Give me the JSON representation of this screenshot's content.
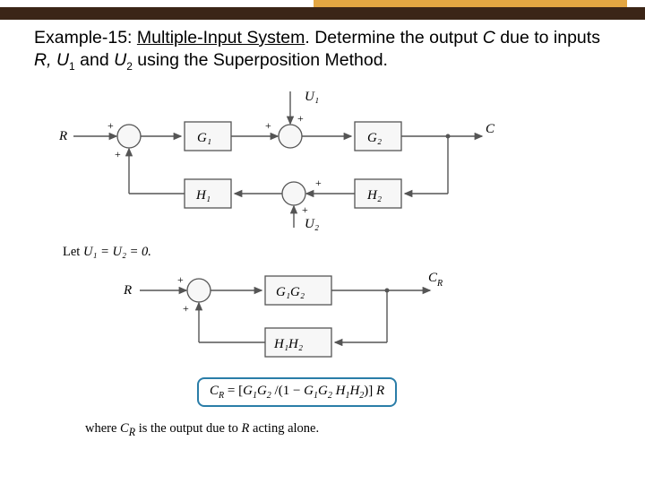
{
  "heading": {
    "example_label": "Example-15:",
    "underlined": "Multiple-Input System",
    "rest1": ". Determine the output ",
    "C": "C",
    "rest2": " due to inputs ",
    "R": "R",
    "comma": ", ",
    "U1": "U",
    "sub1": "1",
    "and": " and ",
    "U2": "U",
    "sub2": "2",
    "rest3": " using the Superposition Method."
  },
  "diagram1": {
    "R": "R",
    "G1": "G₁",
    "G2": "G₂",
    "H1": "H₁",
    "H2": "H₂",
    "U1": "U₁",
    "U2": "U₂",
    "C": "C",
    "plus": "+",
    "minus": ""
  },
  "let_line": {
    "let": "Let ",
    "eq": "U₁ = U₂ = 0."
  },
  "diagram2": {
    "R": "R",
    "G1G2": "G₁G₂",
    "H1H2": "H₁H₂",
    "CR": "C",
    "CR_sub": "R",
    "plus": "+"
  },
  "equation": {
    "text": "C_R = [G₁G₂ /(1 − G₁G₂ H₁H₂)] R"
  },
  "bottom": {
    "where": "where ",
    "CR": "C",
    "CR_sub": "R",
    "rest": " is the output due to ",
    "R": "R",
    "tail": " acting alone."
  },
  "chart_data": {
    "type": "diagram",
    "systems": [
      {
        "name": "original",
        "inputs": [
          "R",
          "U1",
          "U2"
        ],
        "output": "C",
        "forward_blocks": [
          "G1",
          "G2"
        ],
        "feedback_blocks": [
          "H2",
          "H1"
        ],
        "summing_junctions": [
          {
            "inputs": [
              "R(+)",
              "feedback(+)"
            ]
          },
          {
            "inputs": [
              "G1(+)",
              "U1(+)"
            ]
          },
          {
            "inputs": [
              "H2(+)",
              "U2(+)"
            ]
          }
        ]
      },
      {
        "name": "reduced_R_only",
        "condition": "U1=U2=0",
        "input": "R",
        "output": "C_R",
        "forward_block": "G1G2",
        "feedback_block": "H1H2",
        "closed_loop": "C_R = [G1G2 / (1 - G1G2 H1H2)] R"
      }
    ]
  }
}
